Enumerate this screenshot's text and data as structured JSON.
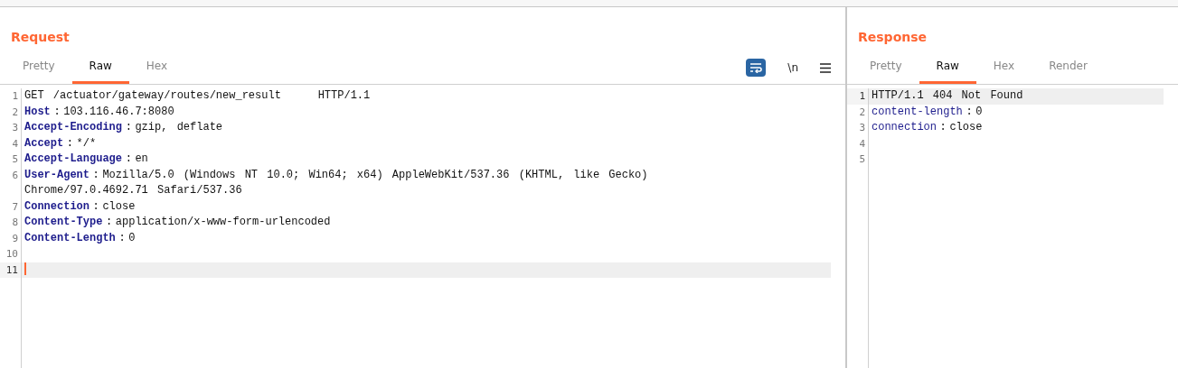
{
  "panes": [
    {
      "title": "Request",
      "tabs": [
        {
          "label": "Pretty",
          "selected": false
        },
        {
          "label": "Raw",
          "selected": true
        },
        {
          "label": "Hex",
          "selected": false
        }
      ],
      "toolbar": {
        "wrap_on": true,
        "newline_label": "\\n"
      },
      "bold_keys": true,
      "lines": [
        {
          "number": "1",
          "text": "GET /actuator/gateway/routes/new_result    HTTP/1.1",
          "current": false
        },
        {
          "number": "2",
          "key": "Host",
          "separator": ":",
          "value": "103.116.46.7:8080",
          "current": false
        },
        {
          "number": "3",
          "key": "Accept-Encoding",
          "separator": ":",
          "value": "gzip, deflate",
          "current": false
        },
        {
          "number": "4",
          "key": "Accept",
          "separator": ":",
          "value": "*/*",
          "current": false
        },
        {
          "number": "5",
          "key": "Accept-Language",
          "separator": ":",
          "value": "en",
          "current": false
        },
        {
          "number": "6",
          "key": "User-Agent",
          "separator": ":",
          "value": "Mozilla/5.0 (Windows NT 10.0; Win64; x64) AppleWebKit/537.36 (KHTML, like Gecko)",
          "continuation": "Chrome/97.0.4692.71 Safari/537.36",
          "current": false
        },
        {
          "number": "7",
          "key": "Connection",
          "separator": ":",
          "value": "close",
          "current": false
        },
        {
          "number": "8",
          "key": "Content-Type",
          "separator": ":",
          "value": "application/x-www-form-urlencoded",
          "current": false
        },
        {
          "number": "9",
          "key": "Content-Length",
          "separator": ":",
          "value": "0",
          "current": false
        },
        {
          "number": "10",
          "current": false
        },
        {
          "number": "11",
          "current": true
        }
      ]
    },
    {
      "title": "Response",
      "tabs": [
        {
          "label": "Pretty",
          "selected": false
        },
        {
          "label": "Raw",
          "selected": true
        },
        {
          "label": "Hex",
          "selected": false
        },
        {
          "label": "Render",
          "selected": false
        }
      ],
      "bold_keys": false,
      "lines": [
        {
          "number": "1",
          "text": "HTTP/1.1 404 Not Found",
          "current": true
        },
        {
          "number": "2",
          "key": "content-length",
          "separator": ":",
          "value": "0",
          "current": false
        },
        {
          "number": "3",
          "key": "connection",
          "separator": ":",
          "value": "close",
          "current": false
        },
        {
          "number": "4",
          "current": false
        },
        {
          "number": "5",
          "current": false
        }
      ]
    }
  ]
}
